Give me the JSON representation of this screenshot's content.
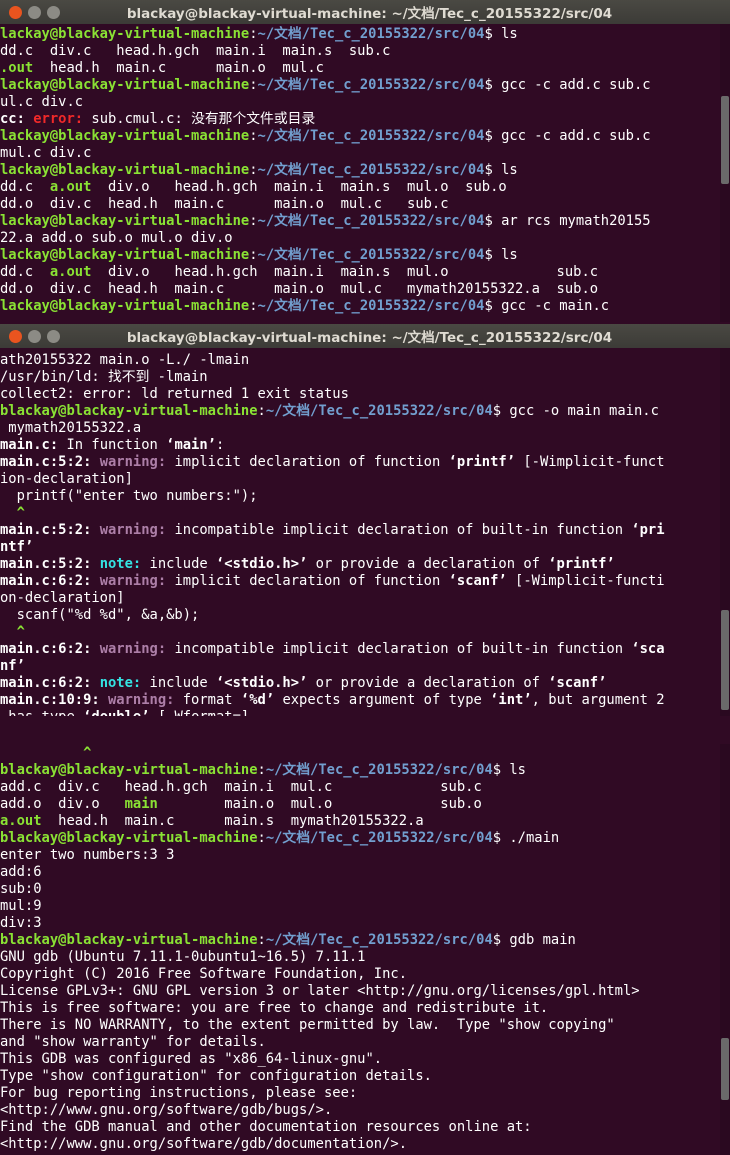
{
  "windows": [
    {
      "title": "blackay@blackay-virtual-machine: ~/文档/Tec_c_20155322/src/04",
      "lines": [
        [
          [
            "g",
            "lackay@blackay-virtual-machine"
          ],
          [
            "w",
            ":"
          ],
          [
            "b",
            "~/文档/Tec_c_20155322/src/04"
          ],
          [
            "w",
            "$ ls"
          ]
        ],
        [
          [
            "w",
            "dd.c  div.c   head.h.gch  main.i  main.s  sub.c"
          ]
        ],
        [
          [
            "g",
            ".out"
          ],
          [
            "w",
            "  head.h  main.c      main.o  mul.c"
          ]
        ],
        [
          [
            "g",
            "lackay@blackay-virtual-machine"
          ],
          [
            "w",
            ":"
          ],
          [
            "b",
            "~/文档/Tec_c_20155322/src/04"
          ],
          [
            "w",
            "$ gcc -c add.c sub.c"
          ]
        ],
        [
          [
            "w",
            "ul.c div.c"
          ]
        ],
        [
          [
            "bw",
            "cc: "
          ],
          [
            "r",
            "error: "
          ],
          [
            "w",
            "sub.cmul.c: 没有那个文件或目录"
          ]
        ],
        [
          [
            "g",
            "lackay@blackay-virtual-machine"
          ],
          [
            "w",
            ":"
          ],
          [
            "b",
            "~/文档/Tec_c_20155322/src/04"
          ],
          [
            "w",
            "$ gcc -c add.c sub.c"
          ]
        ],
        [
          [
            "w",
            "mul.c div.c"
          ]
        ],
        [
          [
            "g",
            "lackay@blackay-virtual-machine"
          ],
          [
            "w",
            ":"
          ],
          [
            "b",
            "~/文档/Tec_c_20155322/src/04"
          ],
          [
            "w",
            "$ ls"
          ]
        ],
        [
          [
            "w",
            "dd.c  "
          ],
          [
            "g",
            "a.out"
          ],
          [
            "w",
            "  div.o   head.h.gch  main.i  main.s  mul.o  sub.o"
          ]
        ],
        [
          [
            "w",
            "dd.o  div.c  head.h  main.c      main.o  mul.c   sub.c"
          ]
        ],
        [
          [
            "g",
            "lackay@blackay-virtual-machine"
          ],
          [
            "w",
            ":"
          ],
          [
            "b",
            "~/文档/Tec_c_20155322/src/04"
          ],
          [
            "w",
            "$ ar rcs mymath20155"
          ]
        ],
        [
          [
            "w",
            "22.a add.o sub.o mul.o div.o"
          ]
        ],
        [
          [
            "g",
            "lackay@blackay-virtual-machine"
          ],
          [
            "w",
            ":"
          ],
          [
            "b",
            "~/文档/Tec_c_20155322/src/04"
          ],
          [
            "w",
            "$ ls"
          ]
        ],
        [
          [
            "w",
            "dd.c  "
          ],
          [
            "g",
            "a.out"
          ],
          [
            "w",
            "  div.o   head.h.gch  main.i  main.s  mul.o             sub.c"
          ]
        ],
        [
          [
            "w",
            "dd.o  div.c  head.h  main.c      main.o  mul.c   mymath20155322.a  sub.o"
          ]
        ],
        [
          [
            "g",
            "lackay@blackay-virtual-machine"
          ],
          [
            "w",
            ":"
          ],
          [
            "b",
            "~/文档/Tec_c_20155322/src/04"
          ],
          [
            "w",
            "$ gcc -c main.c"
          ]
        ]
      ]
    },
    {
      "title": "blackay@blackay-virtual-machine: ~/文档/Tec_c_20155322/src/04",
      "lines": [
        [
          [
            "w",
            "ath20155322 main.o -L./ -lmain"
          ]
        ],
        [
          [
            "w",
            "/usr/bin/ld: 找不到 -lmain"
          ]
        ],
        [
          [
            "w",
            "collect2: error: ld returned 1 exit status"
          ]
        ],
        [
          [
            "g",
            "blackay@blackay-virtual-machine"
          ],
          [
            "w",
            ":"
          ],
          [
            "b",
            "~/文档/Tec_c_20155322/src/04"
          ],
          [
            "w",
            "$ gcc -o main main.c"
          ]
        ],
        [
          [
            "w",
            " mymath20155322.a"
          ]
        ],
        [
          [
            "bw",
            "main.c:"
          ],
          [
            "w",
            " In function "
          ],
          [
            "bw",
            "‘main’"
          ],
          [
            "w",
            ":"
          ]
        ],
        [
          [
            "bw",
            "main.c:5:2: "
          ],
          [
            "m",
            "warning: "
          ],
          [
            "w",
            "implicit declaration of function "
          ],
          [
            "bw",
            "‘printf’"
          ],
          [
            "w",
            " [-Wimplicit-funct"
          ]
        ],
        [
          [
            "w",
            "ion-declaration]"
          ]
        ],
        [
          [
            "w",
            "  printf(\"enter two numbers:\");"
          ]
        ],
        [
          [
            "g",
            "  ^"
          ]
        ],
        [
          [
            "bw",
            "main.c:5:2: "
          ],
          [
            "m",
            "warning: "
          ],
          [
            "w",
            "incompatible implicit declaration of built-in function "
          ],
          [
            "bw",
            "‘pri"
          ]
        ],
        [
          [
            "bw",
            "ntf’"
          ]
        ],
        [
          [
            "bw",
            "main.c:5:2: "
          ],
          [
            "c",
            "note: "
          ],
          [
            "w",
            "include "
          ],
          [
            "bw",
            "‘<stdio.h>’"
          ],
          [
            "w",
            " or provide a declaration of "
          ],
          [
            "bw",
            "‘printf’"
          ]
        ],
        [
          [
            "bw",
            "main.c:6:2: "
          ],
          [
            "m",
            "warning: "
          ],
          [
            "w",
            "implicit declaration of function "
          ],
          [
            "bw",
            "‘scanf’"
          ],
          [
            "w",
            " [-Wimplicit-functi"
          ]
        ],
        [
          [
            "w",
            "on-declaration]"
          ]
        ],
        [
          [
            "w",
            "  scanf(\"%d %d\", &a,&b);"
          ]
        ],
        [
          [
            "g",
            "  ^"
          ]
        ],
        [
          [
            "bw",
            "main.c:6:2: "
          ],
          [
            "m",
            "warning: "
          ],
          [
            "w",
            "incompatible implicit declaration of built-in function "
          ],
          [
            "bw",
            "‘sca"
          ]
        ],
        [
          [
            "bw",
            "nf’"
          ]
        ],
        [
          [
            "bw",
            "main.c:6:2: "
          ],
          [
            "c",
            "note: "
          ],
          [
            "w",
            "include "
          ],
          [
            "bw",
            "‘<stdio.h>’"
          ],
          [
            "w",
            " or provide a declaration of "
          ],
          [
            "bw",
            "‘scanf’"
          ]
        ],
        [
          [
            "bw",
            "main.c:10:9: "
          ],
          [
            "m",
            "warning: "
          ],
          [
            "w",
            "format "
          ],
          [
            "bw",
            "‘%d’"
          ],
          [
            "w",
            " expects argument of type "
          ],
          [
            "bw",
            "‘int’"
          ],
          [
            "w",
            ", but argument 2"
          ]
        ],
        [
          [
            "w",
            " has type "
          ],
          [
            "bw",
            "‘double’"
          ],
          [
            "w",
            " [-Wformat=]"
          ]
        ],
        [
          [
            "w",
            "  printf(\"div:%d\\n\",div(a,b));"
          ]
        ]
      ]
    },
    {
      "lines": [
        [
          [
            "g",
            "          ^"
          ]
        ],
        [
          [
            "g",
            "blackay@blackay-virtual-machine"
          ],
          [
            "w",
            ":"
          ],
          [
            "b",
            "~/文档/Tec_c_20155322/src/04"
          ],
          [
            "w",
            "$ ls"
          ]
        ],
        [
          [
            "w",
            "add.c  div.c   head.h.gch  main.i  mul.c             sub.c"
          ]
        ],
        [
          [
            "w",
            "add.o  div.o   "
          ],
          [
            "g",
            "main"
          ],
          [
            "w",
            "        main.o  mul.o             sub.o"
          ]
        ],
        [
          [
            "g",
            "a.out"
          ],
          [
            "w",
            "  head.h  main.c      main.s  mymath20155322.a"
          ]
        ],
        [
          [
            "g",
            "blackay@blackay-virtual-machine"
          ],
          [
            "w",
            ":"
          ],
          [
            "b",
            "~/文档/Tec_c_20155322/src/04"
          ],
          [
            "w",
            "$ ./main"
          ]
        ],
        [
          [
            "w",
            "enter two numbers:3 3"
          ]
        ],
        [
          [
            "w",
            "add:6"
          ]
        ],
        [
          [
            "w",
            "sub:0"
          ]
        ],
        [
          [
            "w",
            "mul:9"
          ]
        ],
        [
          [
            "w",
            "div:3"
          ]
        ],
        [
          [
            "g",
            "blackay@blackay-virtual-machine"
          ],
          [
            "w",
            ":"
          ],
          [
            "b",
            "~/文档/Tec_c_20155322/src/04"
          ],
          [
            "w",
            "$ gdb main"
          ]
        ],
        [
          [
            "w",
            "GNU gdb (Ubuntu 7.11.1-0ubuntu1~16.5) 7.11.1"
          ]
        ],
        [
          [
            "w",
            "Copyright (C) 2016 Free Software Foundation, Inc."
          ]
        ],
        [
          [
            "w",
            "License GPLv3+: GNU GPL version 3 or later <http://gnu.org/licenses/gpl.html>"
          ]
        ],
        [
          [
            "w",
            "This is free software: you are free to change and redistribute it."
          ]
        ],
        [
          [
            "w",
            "There is NO WARRANTY, to the extent permitted by law.  Type \"show copying\""
          ]
        ],
        [
          [
            "w",
            "and \"show warranty\" for details."
          ]
        ],
        [
          [
            "w",
            "This GDB was configured as \"x86_64-linux-gnu\"."
          ]
        ],
        [
          [
            "w",
            "Type \"show configuration\" for configuration details."
          ]
        ],
        [
          [
            "w",
            "For bug reporting instructions, please see:"
          ]
        ],
        [
          [
            "w",
            "<http://www.gnu.org/software/gdb/bugs/>."
          ]
        ],
        [
          [
            "w",
            "Find the GDB manual and other documentation resources online at:"
          ]
        ],
        [
          [
            "w",
            "<http://www.gnu.org/software/gdb/documentation/>."
          ]
        ]
      ]
    }
  ]
}
